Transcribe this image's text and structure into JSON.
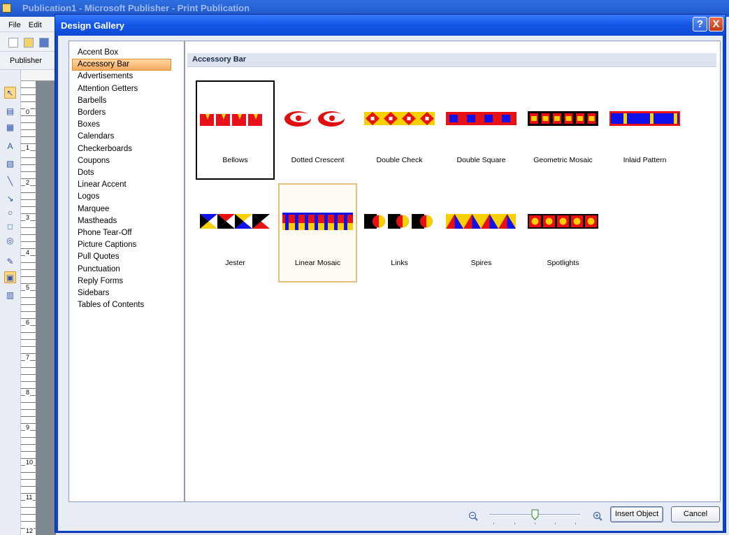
{
  "app": {
    "title_visible": "Publication1 - Microsoft Publisher - Print Publication",
    "menu": [
      "File",
      "Edit"
    ],
    "toolbar_task_label": "Publisher",
    "ruler_numbers": [
      "0",
      "1",
      "2",
      "3",
      "4",
      "5",
      "6",
      "7",
      "8",
      "9",
      "10",
      "11",
      "12"
    ]
  },
  "dialog": {
    "title": "Design Gallery",
    "help_glyph": "?",
    "close_glyph": "X"
  },
  "categories": {
    "selected": "Accessory Bar",
    "items": [
      "Accent Box",
      "Accessory Bar",
      "Advertisements",
      "Attention Getters",
      "Barbells",
      "Borders",
      "Boxes",
      "Calendars",
      "Checkerboards",
      "Coupons",
      "Dots",
      "Linear Accent",
      "Logos",
      "Marquee",
      "Mastheads",
      "Phone Tear-Off",
      "Picture Captions",
      "Pull Quotes",
      "Punctuation",
      "Reply Forms",
      "Sidebars",
      "Tables of Contents"
    ]
  },
  "gallery": {
    "header": "Accessory Bar",
    "selected_item": "Bellows",
    "hovered_item": "Linear Mosaic",
    "items": [
      {
        "label": "Bellows",
        "pattern": "bellows",
        "colors": [
          "#e8101a",
          "#f8d800"
        ]
      },
      {
        "label": "Dotted Crescent",
        "pattern": "crescent",
        "colors": [
          "#e01010"
        ]
      },
      {
        "label": "Double Check",
        "pattern": "double-check",
        "colors": [
          "#f8d000",
          "#e81010",
          "#ffffff"
        ]
      },
      {
        "label": "Double Square",
        "pattern": "double-square",
        "colors": [
          "#e81010",
          "#1010e8"
        ]
      },
      {
        "label": "Geometric Mosaic",
        "pattern": "geometric-mosaic",
        "colors": [
          "#000000",
          "#e81010",
          "#f8d000"
        ]
      },
      {
        "label": "Inlaid Pattern",
        "pattern": "inlaid",
        "colors": [
          "#1010e8",
          "#e81010",
          "#f8d000"
        ]
      },
      {
        "label": "Jester",
        "pattern": "jester",
        "colors": [
          "#1010e8",
          "#000000",
          "#f8d000",
          "#e81010"
        ]
      },
      {
        "label": "Linear Mosaic",
        "pattern": "linear-mosaic",
        "colors": [
          "#e81010",
          "#1010e8",
          "#f8d000"
        ]
      },
      {
        "label": "Links",
        "pattern": "links",
        "colors": [
          "#000000",
          "#e81010",
          "#f8d000"
        ]
      },
      {
        "label": "Spires",
        "pattern": "spires",
        "colors": [
          "#1010e8",
          "#e81010",
          "#f8d000"
        ]
      },
      {
        "label": "Spotlights",
        "pattern": "spotlights",
        "colors": [
          "#000000",
          "#e81010",
          "#f8d000"
        ]
      }
    ]
  },
  "footer": {
    "zoom_level_fraction": 0.5,
    "insert_label": "Insert Object",
    "cancel_label": "Cancel"
  }
}
